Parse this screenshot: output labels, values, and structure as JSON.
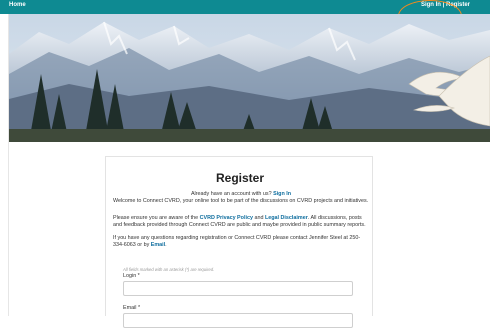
{
  "nav": {
    "home": "Home",
    "sign_in": "Sign In",
    "separator": " | ",
    "register": "Register"
  },
  "colors": {
    "nav_bg": "#0e8a92",
    "highlight_oval": "#f08a1e",
    "link": "#0e6d9e"
  },
  "hero": {
    "description_icon": "mountain-lake-swans-image"
  },
  "register": {
    "title": "Register",
    "have_account_prefix": "Already have an account with us? ",
    "have_account_link": "Sign In",
    "welcome": "Welcome to Connect CVRD, your online tool to be part of the discussions on CVRD projects and initiatives.",
    "policy_prefix": "Please ensure you are aware of the ",
    "privacy_link": "CVRD Privacy Policy",
    "and": " and ",
    "legal_link": "Legal Disclaimer",
    "policy_suffix": ". All discussions, posts and feedback provided through Connect CVRD are public and maybe provided in public summary reports.",
    "questions_prefix": "If you have any questions regarding registration or Connect CVRD please contact Jennifer Steel at 250-334-6063 or by ",
    "email_link": "Email",
    "questions_suffix": ".",
    "required_note": "All fields marked with an asterisk (*) are required.",
    "login_label": "Login *",
    "email_label": "Email *"
  }
}
